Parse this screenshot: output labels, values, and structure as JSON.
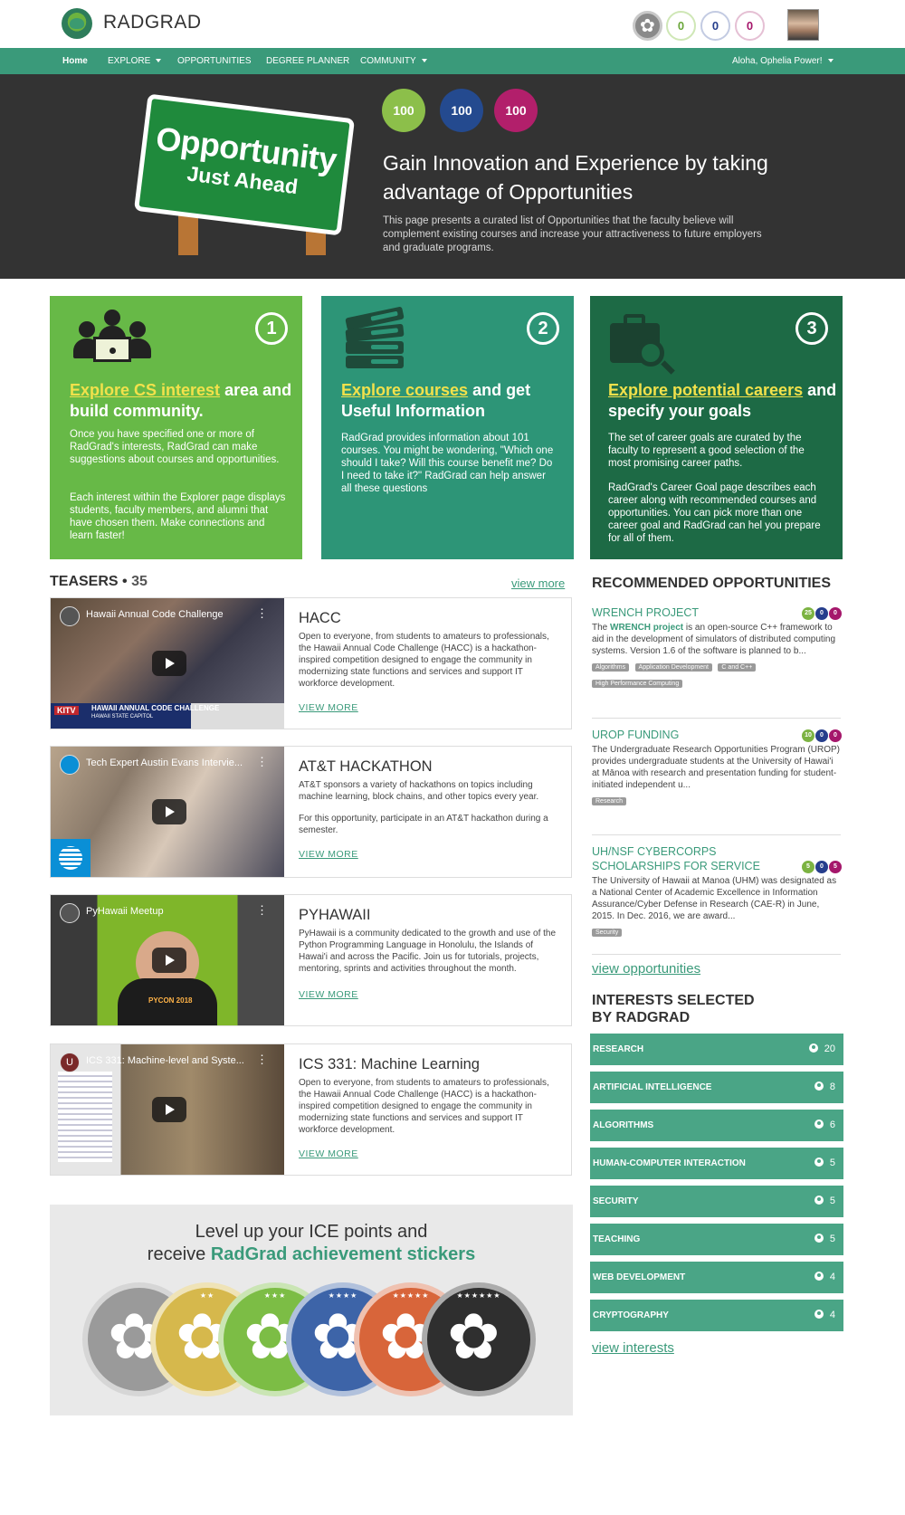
{
  "header": {
    "brand": "RADGRAD",
    "ice": [
      {
        "value": "0",
        "color": "#8dc642"
      },
      {
        "value": "0",
        "color": "#263e8c"
      },
      {
        "value": "0",
        "color": "#a5176b"
      }
    ]
  },
  "nav": {
    "home": "Home",
    "explore": "EXPLORE",
    "opportunities": "OPPORTUNITIES",
    "degree_planner": "DEGREE PLANNER",
    "community": "COMMUNITY",
    "greeting": "Aloha, Ophelia Power!"
  },
  "hero": {
    "sign_line1": "Opportunity",
    "sign_line2": "Just Ahead",
    "circles": [
      {
        "value": "100",
        "color": "#8cbf4a"
      },
      {
        "value": "100",
        "color": "#244a8f"
      },
      {
        "value": "100",
        "color": "#b21f6b"
      }
    ],
    "title": "Gain Innovation and Experience by taking advantage of Opportunities",
    "description": "This page presents a curated list of Opportunities that the faculty believe will complement existing courses and increase your attractiveness to future employers and graduate programs."
  },
  "cards": [
    {
      "number": "1",
      "highlight": "Explore CS interest",
      "heading_after": " area and build community.",
      "p1": "Once you have specified one or more of RadGrad's interests, RadGrad can make suggestions about courses and opportunities.",
      "p2": "Each interest within the Explorer page displays students, faculty members, and alumni that have chosen them. Make connections and learn faster!",
      "color": "#67b947"
    },
    {
      "number": "2",
      "highlight": "Explore courses",
      "heading_after": " and get Useful Information",
      "p1": "RadGrad provides information about 101 courses. You might be wondering, \"Which one should I take? Will this course benefit me? Do I need to take it?\" RadGrad can help answer all these questions",
      "color": "#2d9577"
    },
    {
      "number": "3",
      "highlight": "Explore potential careers",
      "heading_after": " and specify your goals",
      "p1": "The set of career goals are curated by the faculty to represent a good selection of the most promising career paths.",
      "p2": "RadGrad's Career Goal page describes each career along with recommended courses and opportunities. You can pick more than one career goal and RadGrad can hel you prepare for all of them.",
      "color": "#1d6a45"
    }
  ],
  "teasers": {
    "title": "TEASERS",
    "count": "35",
    "view_more": "view more",
    "items": [
      {
        "video_title": "Hawaii Annual Code Challenge",
        "lower_third": "HAWAII ANNUAL CODE CHALLENGE",
        "lower_sub": "HAWAII STATE CAPITOL",
        "channel": "KITV",
        "title": "HACC",
        "desc": "Open to everyone, from students to amateurs to professionals, the Hawaii Annual Code Challenge (HACC) is a hackathon-inspired competition designed to engage the community in modernizing state functions and services and support IT workforce development.",
        "more": "VIEW MORE"
      },
      {
        "video_title": "Tech Expert Austin Evans Intervie...",
        "title": "AT&T HACKATHON",
        "desc": "AT&T sponsors a variety of hackathons on topics including machine learning, block chains, and other topics every year.",
        "desc2": "For this opportunity, participate in an AT&T hackathon during a semester.",
        "more": "VIEW MORE"
      },
      {
        "video_title": "PyHawaii Meetup",
        "shirt": "PYCON 2018",
        "title": "PYHAWAII",
        "desc": "PyHawaii is a community dedicated to the growth and use of the Python Programming Language in Honolulu, the Islands of Hawai'i and across the Pacific. Join us for tutorials, projects, mentoring, sprints and activities throughout the month.",
        "more": "VIEW MORE"
      },
      {
        "video_title": "ICS 331: Machine-level and Syste...",
        "avatar_letter": "U",
        "title": "ICS 331: Machine Learning",
        "desc": "Open to everyone, from students to amateurs to professionals, the Hawaii Annual Code Challenge (HACC) is a hackathon-inspired competition designed to engage the community in modernizing state functions and services and support IT workforce development.",
        "more": "VIEW MORE"
      }
    ]
  },
  "stickers": {
    "line1": "Level up your ICE points and",
    "line2_pre": "receive ",
    "line2_bold": "RadGrad achievement stickers",
    "badges": [
      {
        "color": "#9a9a9a",
        "stars": ""
      },
      {
        "color": "#d6b84c",
        "stars": "★★"
      },
      {
        "color": "#7cbd45",
        "stars": "★★★"
      },
      {
        "color": "#3d64a8",
        "stars": "★★★★"
      },
      {
        "color": "#d8653a",
        "stars": "★★★★★"
      },
      {
        "color": "#2f2f2f",
        "stars": "★★★★★★"
      }
    ]
  },
  "recommended": {
    "title": "RECOMMENDED OPPORTUNITIES",
    "view_link": "view opportunities",
    "items": [
      {
        "title": "WRENCH PROJECT",
        "desc_pre": "The ",
        "desc_bold": "WRENCH project",
        "desc": " is an open-source C++ framework to aid in the development of simulators of distributed computing systems. Version 1.6 of the software is planned to b...",
        "points": [
          "25",
          "0",
          "0"
        ],
        "tags": [
          "Algorithms",
          "Application Development",
          "C and C++",
          "High Performance Computing"
        ]
      },
      {
        "title": "UROP FUNDING",
        "desc": "The Undergraduate Research Opportunities Program (UROP) provides undergraduate students at the University of Hawai'i at Mānoa with research and presentation funding for student-initiated independent u...",
        "points": [
          "10",
          "0",
          "0"
        ],
        "tags": [
          "Research"
        ]
      },
      {
        "title": "UH/NSF CYBERCORPS SCHOLARSHIPS FOR SERVICE",
        "desc": "The University of Hawaii at Manoa (UHM) was designated as a National Center of Academic Excellence in Information Assurance/Cyber Defense in Research (CAE-R) in June, 2015. In Dec. 2016, we are award...",
        "points": [
          "5",
          "0",
          "5"
        ],
        "tags": [
          "Security"
        ]
      }
    ]
  },
  "interests": {
    "title_line1": "INTERESTS SELECTED",
    "title_line2": "BY RADGRAD",
    "view_link": "view interests",
    "items": [
      {
        "name": "RESEARCH",
        "count": "20"
      },
      {
        "name": "ARTIFICIAL INTELLIGENCE",
        "count": "8"
      },
      {
        "name": "ALGORITHMS",
        "count": "6"
      },
      {
        "name": "HUMAN-COMPUTER INTERACTION",
        "count": "5"
      },
      {
        "name": "SECURITY",
        "count": "5"
      },
      {
        "name": "TEACHING",
        "count": "5"
      },
      {
        "name": "WEB DEVELOPMENT",
        "count": "4"
      },
      {
        "name": "CRYPTOGRAPHY",
        "count": "4"
      }
    ]
  }
}
